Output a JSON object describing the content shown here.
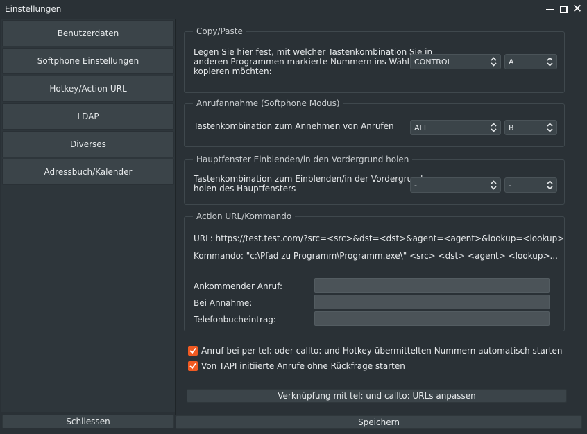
{
  "window": {
    "title": "Einstellungen"
  },
  "sidebar": {
    "items": [
      {
        "label": "Benutzerdaten"
      },
      {
        "label": "Softphone Einstellungen"
      },
      {
        "label": "Hotkey/Action URL"
      },
      {
        "label": "LDAP"
      },
      {
        "label": "Diverses"
      },
      {
        "label": "Adressbuch/Kalender"
      }
    ],
    "close_label": "Schliessen"
  },
  "copy_paste": {
    "title": "Copy/Paste",
    "desc_line1": "Legen Sie hier fest, mit welcher Tastenkombination Sie in",
    "desc_line2": "anderen Programmen markierte Nummern ins Wählfeld",
    "desc_line3": "kopieren möchten:",
    "modifier": "CONTROL",
    "key": "A"
  },
  "answer": {
    "title": "Anrufannahme (Softphone Modus)",
    "desc": "Tastenkombination zum Annehmen von Anrufen",
    "modifier": "ALT",
    "key": "B"
  },
  "foreground": {
    "title": "Hauptfenster Einblenden/in den Vordergrund holen",
    "desc_line1": "Tastenkombination zum Einblenden/in der Vordergrund",
    "desc_line2": "holen des Hauptfensters",
    "modifier": "-",
    "key": "-"
  },
  "action": {
    "title": "Action URL/Kommando",
    "url_text": "URL: https://test.test.com/?src=<src>&dst=<dst>&agent=<agent>&lookup=<lookup>",
    "cmd_text": "Kommando: \"c:\\Pfad zu Programm\\Programm.exe\\\" <src> <dst> <agent> <lookup>...",
    "incoming_label": "Ankommender Anruf:",
    "incoming_value": "",
    "accept_label": "Bei Annahme:",
    "accept_value": "",
    "phonebook_label": "Telefonbucheintrag:",
    "phonebook_value": ""
  },
  "options": {
    "autostart_label": "Anruf bei per tel: oder callto: und Hotkey übermittelten Nummern automatisch starten",
    "autostart_checked": true,
    "tapi_label": "Von TAPI initiierte Anrufe ohne Rückfrage starten",
    "tapi_checked": true
  },
  "link_button_label": "Verknüpfung mit tel: und callto: URLs anpassen",
  "save_label": "Speichern",
  "colors": {
    "accent": "#f05a22",
    "background": "#2a3136",
    "button": "#3b4449"
  }
}
